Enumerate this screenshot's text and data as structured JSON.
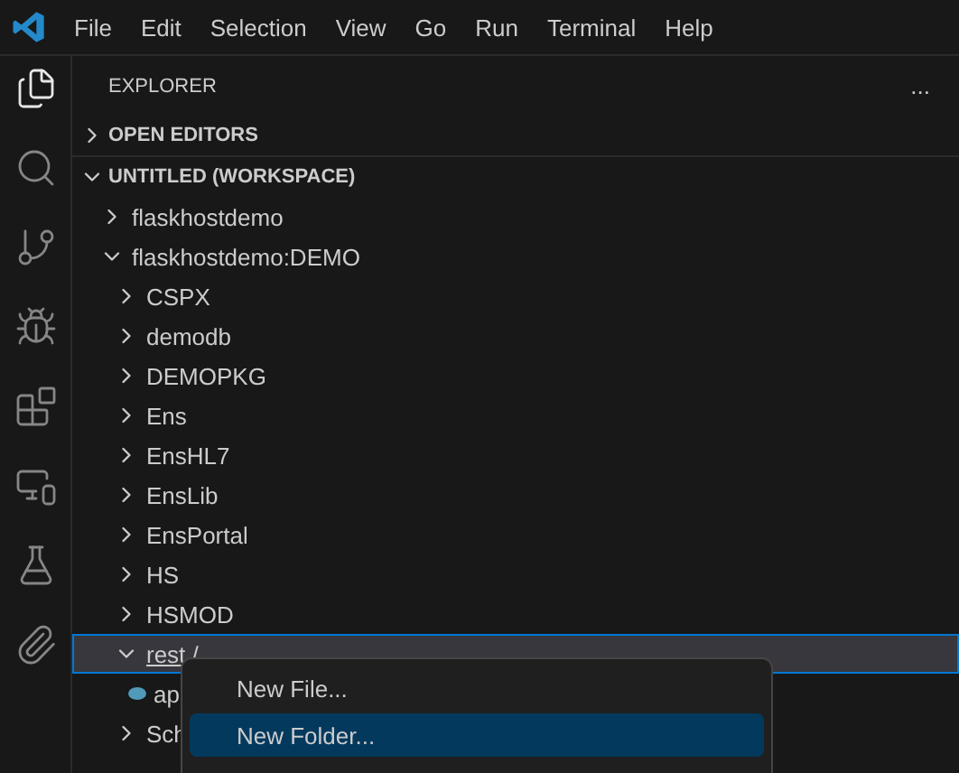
{
  "menu_bar": [
    "File",
    "Edit",
    "Selection",
    "View",
    "Go",
    "Run",
    "Terminal",
    "Help"
  ],
  "activity_bar": [
    {
      "selected": true
    },
    {
      "selected": false
    },
    {
      "selected": false
    },
    {
      "selected": false
    },
    {
      "selected": false
    },
    {
      "selected": false
    },
    {
      "selected": false
    },
    {
      "selected": false
    }
  ],
  "sidebar": {
    "title": "EXPLORER",
    "more": "...",
    "sections": [
      {
        "label": "OPEN EDITORS",
        "expanded": false
      },
      {
        "label": "UNTITLED (WORKSPACE)",
        "expanded": true
      }
    ],
    "tree": [
      {
        "label": "flaskhostdemo",
        "kind": "folder",
        "expanded": false,
        "selected": false
      },
      {
        "label": "flaskhostdemo:DEMO",
        "kind": "folder",
        "expanded": true,
        "selected": false,
        "children": [
          {
            "label": "CSPX",
            "kind": "folder",
            "expanded": false,
            "selected": false
          },
          {
            "label": "demodb",
            "kind": "folder",
            "expanded": false,
            "selected": false
          },
          {
            "label": "DEMOPKG",
            "kind": "folder",
            "expanded": false,
            "selected": false
          },
          {
            "label": "Ens",
            "kind": "folder",
            "expanded": false,
            "selected": false
          },
          {
            "label": "EnsHL7",
            "kind": "folder",
            "expanded": false,
            "selected": false
          },
          {
            "label": "EnsLib",
            "kind": "folder",
            "expanded": false,
            "selected": false
          },
          {
            "label": "EnsPortal",
            "kind": "folder",
            "expanded": false,
            "selected": false
          },
          {
            "label": "HS",
            "kind": "folder",
            "expanded": false,
            "selected": false
          },
          {
            "label": "HSMOD",
            "kind": "folder",
            "expanded": false,
            "selected": false
          },
          {
            "label": "rest /",
            "kind": "folder",
            "expanded": true,
            "selected": true,
            "children": [
              {
                "label": "ap",
                "kind": "file",
                "selected": false
              }
            ]
          },
          {
            "label": "Sch",
            "kind": "folder",
            "expanded": false,
            "selected": false
          }
        ]
      }
    ]
  },
  "context_menu": [
    {
      "label": "New File...",
      "selected": false
    },
    {
      "label": "New Folder...",
      "selected": true
    }
  ]
}
